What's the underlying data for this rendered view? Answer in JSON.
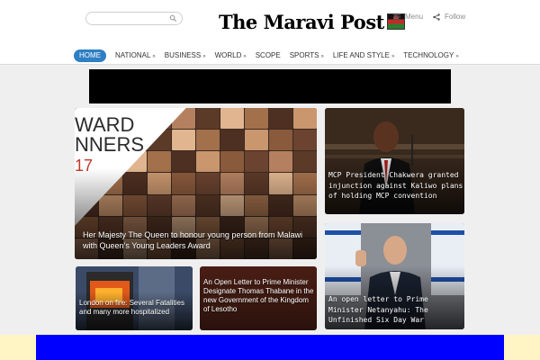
{
  "header": {
    "search_placeholder": "",
    "logo_text": "The Maravi Post",
    "menu_label": "Menu",
    "follow_label": "Follow"
  },
  "nav": {
    "items": [
      {
        "label": "HOME",
        "active": true,
        "dropdown": false
      },
      {
        "label": "NATIONAL",
        "active": false,
        "dropdown": true
      },
      {
        "label": "BUSINESS",
        "active": false,
        "dropdown": true
      },
      {
        "label": "WORLD",
        "active": false,
        "dropdown": true
      },
      {
        "label": "SCOPE",
        "active": false,
        "dropdown": false
      },
      {
        "label": "SPORTS",
        "active": false,
        "dropdown": true
      },
      {
        "label": "LIFE AND STYLE",
        "active": false,
        "dropdown": true
      },
      {
        "label": "TECHNOLOGY",
        "active": false,
        "dropdown": true
      }
    ],
    "caret": "»"
  },
  "stories": {
    "main": {
      "title": "Her Majesty The Queen to honour young person from Malawi with Queen’s Young Leaders Award",
      "image_text_1": "WARD",
      "image_text_2": "NNERS",
      "image_text_3": "17"
    },
    "chakwera": {
      "title": "MCP President Chakwera granted injunction against Kaliwo plans of holding MCP convention"
    },
    "netanyahu": {
      "title": "An open letter to Prime Minister Netanyahu: The Unfinished Six Day War"
    },
    "london": {
      "title": "London on fire: Several Fatalities and many more hospitalized"
    },
    "letter": {
      "title": "An Open Letter to Prime Minister Designate Thomas Thabane in the new Government of the Kingdom of Lesotho"
    }
  },
  "colors": {
    "nav_active": "#2f7fc4",
    "ad_banner": "#000000",
    "bottom_banner": "#0000ff",
    "bottom_side": "#fff5c4"
  }
}
